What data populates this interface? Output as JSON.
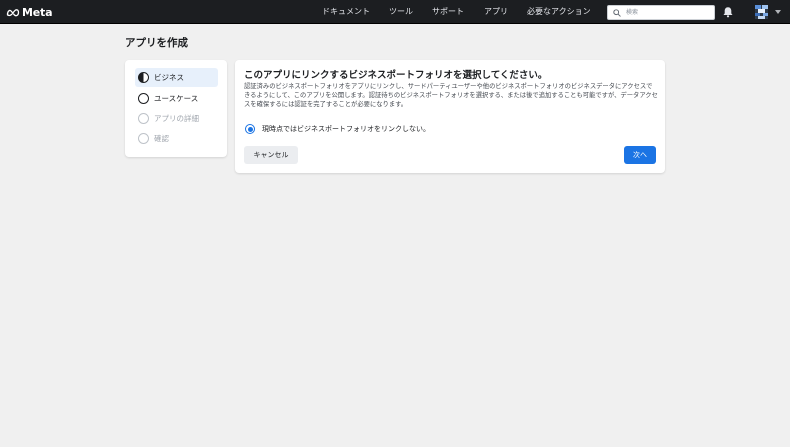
{
  "app": {
    "logo_text": "Meta"
  },
  "nav": {
    "items": [
      {
        "label": "ドキュメント"
      },
      {
        "label": "ツール"
      },
      {
        "label": "サポート"
      },
      {
        "label": "アプリ"
      },
      {
        "label": "必要なアクション"
      }
    ],
    "search_placeholder": "検索"
  },
  "page": {
    "title": "アプリを作成"
  },
  "steps": [
    {
      "label": "ビジネス",
      "state": "active"
    },
    {
      "label": "ユースケース",
      "state": "todo"
    },
    {
      "label": "アプリの詳細",
      "state": "disabled"
    },
    {
      "label": "確認",
      "state": "disabled"
    }
  ],
  "card": {
    "heading": "このアプリにリンクするビジネスポートフォリオを選択してください。",
    "description": "認証済みのビジネスポートフォリオをアプリにリンクし、サードパーティユーザーや他のビジネスポートフォリオのビジネスデータにアクセスできるようにして、このアプリを公開します。認証待ちのビジネスポートフォリオを選択する、または後で追加することも可能ですが、データアクセスを確保するには認証を完了することが必要になります。",
    "option_label": "現時点ではビジネスポートフォリオをリンクしない。",
    "option_selected": true,
    "cancel_label": "キャンセル",
    "next_label": "次へ"
  },
  "colors": {
    "topbar": "#1c1e21",
    "background": "#f0f0f0",
    "accent": "#1b74e4",
    "active_step_bg": "#e7f0fb"
  },
  "icons": {
    "logo": "meta-infinity-icon",
    "search": "search-icon",
    "notifications": "bell-icon",
    "account": "avatar",
    "menu": "chevron-down-icon"
  }
}
